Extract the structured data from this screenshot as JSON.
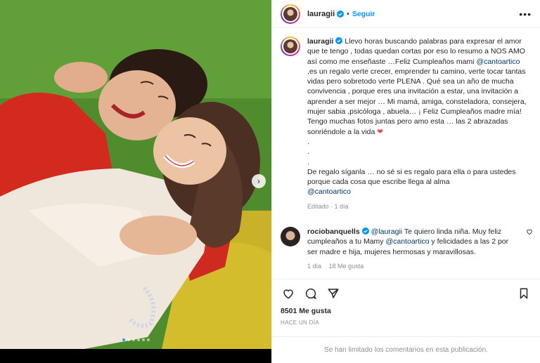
{
  "post": {
    "author": "lauragii",
    "follow_label": "Seguir",
    "separator": "•",
    "more_label": "•••",
    "verified": true
  },
  "media": {
    "next_arrow": "›",
    "slide_count": 6,
    "active_slide": 1
  },
  "caption": {
    "author": "lauragii",
    "lines": [
      "Llevo horas buscando palabras para expresar el amor que te tengo , todas quedan cortas por eso lo resumo a NOS AMO así como me enseñaste …Feliz Cumpleaños mami ",
      "@cantoartico",
      " ,es un regalo verte crecer, emprender tu camino, verte tocar tantas vidas pero sobretodo verte PLENA . Qué sea un año de mucha convivencia , porque eres una invitación a estar, una invitación a aprender a ser mejor … Mi mamá, amiga, consteladora, consejera, mujer sabia ,psicóloga , abuela… ¡ Feliz Cumpleaños madre mía! Tengo muchas fotos juntas pero amo esta … las 2 abrazadas sonriéndole a la vida ",
      "❤",
      "De regalo síganla … no sé si es regalo para ella o para ustedes porque cada cosa que escribe llega al alma",
      "@cantoartico"
    ],
    "dots": [
      ".",
      ".",
      "."
    ],
    "meta": "Editado · 1 día"
  },
  "comment": {
    "author": "rociobanquells",
    "mention": "@lauragii",
    "text_a": " Te quiero linda niña. Muy feliz cumpleaños a tu Mamy ",
    "mention2": "@cantoartico",
    "text_b": " y felicidades a las 2 por ser madre e hija, mujeres hermosas y maravillosas.",
    "age": "1 día",
    "likes": "18 Me gusta",
    "like_icon": "heart-outline-icon"
  },
  "actions": {
    "icons": [
      "heart-outline-icon",
      "comment-icon",
      "share-icon",
      "bookmark-icon"
    ]
  },
  "stats": {
    "likes": "8501 Me gusta",
    "date": "HACE UN DÍA"
  },
  "footer": {
    "limited_text": "Se han limitado los comentarios en esta publicación."
  },
  "colors": {
    "link": "#00376b",
    "follow": "#0095f6",
    "verified": "#0095f6",
    "muted": "#8e8e8e",
    "heart": "#ed4956"
  }
}
